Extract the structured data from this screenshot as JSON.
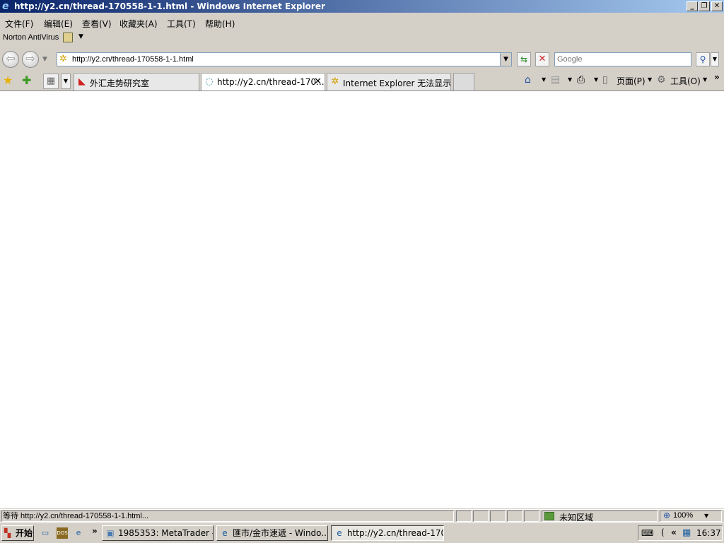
{
  "window": {
    "title": "http://y2.cn/thread-170558-1-1.html - Windows Internet Explorer",
    "icon": "ie-icon",
    "controls": [
      "minimize-button",
      "restore-button",
      "close-button"
    ]
  },
  "menubar": {
    "items": [
      "文件(F)",
      "编辑(E)",
      "查看(V)",
      "收藏夹(A)",
      "工具(T)",
      "帮助(H)"
    ]
  },
  "norton": {
    "label": "Norton AntiVirus"
  },
  "address": {
    "url": "http://y2.cn/thread-170558-1-1.html",
    "search_placeholder": "Google"
  },
  "tabs": [
    {
      "label": "外汇走势研究室",
      "icon": "forex-site-icon",
      "active": false
    },
    {
      "label": "http://y2.cn/thread-170...",
      "icon": "loading-icon",
      "active": true
    },
    {
      "label": "Internet Explorer 无法显示...",
      "icon": "page-icon",
      "active": false
    }
  ],
  "commands": {
    "page_label": "页面(P)",
    "tools_label": "工具(O)"
  },
  "statusbar": {
    "text": "等待 http://y2.cn/thread-170558-1-1.html...",
    "zone": "未知区域",
    "zoom": "100%"
  },
  "taskbar": {
    "start_label": "开始",
    "buttons": [
      {
        "label": "1985353: MetaTrader - ...",
        "icon": "metatrader-icon",
        "active": false
      },
      {
        "label": "匯市/金市速遞 - Windo...",
        "icon": "ie-icon",
        "active": false
      },
      {
        "label": "http://y2.cn/thread-170...",
        "icon": "ie-icon",
        "active": true
      }
    ],
    "clock": "16:37"
  }
}
